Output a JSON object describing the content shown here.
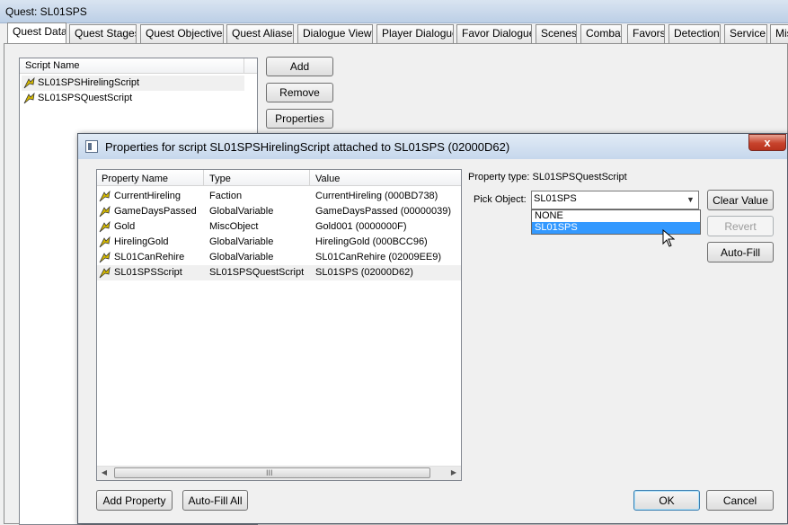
{
  "window": {
    "title": "Quest: SL01SPS"
  },
  "tabs": [
    {
      "label": "Quest Data"
    },
    {
      "label": "Quest Stages"
    },
    {
      "label": "Quest Objectives"
    },
    {
      "label": "Quest Aliases"
    },
    {
      "label": "Dialogue Views"
    },
    {
      "label": "Player Dialogue"
    },
    {
      "label": "Favor Dialogue"
    },
    {
      "label": "Scenes"
    },
    {
      "label": "Combat"
    },
    {
      "label": "Favors"
    },
    {
      "label": "Detection"
    },
    {
      "label": "Service"
    },
    {
      "label": "Mis"
    }
  ],
  "scripts": {
    "header": "Script Name",
    "items": [
      {
        "name": "SL01SPSHirelingScript"
      },
      {
        "name": "SL01SPSQuestScript"
      }
    ],
    "buttons": {
      "add": "Add",
      "remove": "Remove",
      "properties": "Properties"
    }
  },
  "dialog": {
    "title": "Properties for script SL01SPSHirelingScript attached to SL01SPS (02000D62)",
    "close": "x",
    "table": {
      "headers": [
        "Property Name",
        "Type",
        "Value"
      ],
      "rows": [
        {
          "name": "CurrentHireling",
          "type": "Faction",
          "value": "CurrentHireling (000BD738)"
        },
        {
          "name": "GameDaysPassed",
          "type": "GlobalVariable",
          "value": "GameDaysPassed (00000039)"
        },
        {
          "name": "Gold",
          "type": "MiscObject",
          "value": "Gold001 (0000000F)"
        },
        {
          "name": "HirelingGold",
          "type": "GlobalVariable",
          "value": "HirelingGold (000BCC96)"
        },
        {
          "name": "SL01CanRehire",
          "type": "GlobalVariable",
          "value": "SL01CanRehire (02009EE9)"
        },
        {
          "name": "SL01SPSScript",
          "type": "SL01SPSQuestScript",
          "value": "SL01SPS (02000D62)"
        }
      ],
      "scroll_grip": "III"
    },
    "property_type_label": "Property type: SL01SPSQuestScript",
    "pick_object_label": "Pick Object:",
    "pick_object_value": "SL01SPS",
    "dropdown_options": [
      "NONE",
      "SL01SPS"
    ],
    "buttons": {
      "clear_value": "Clear Value",
      "revert": "Revert",
      "auto_fill": "Auto-Fill",
      "add_property": "Add Property",
      "auto_fill_all": "Auto-Fill All",
      "ok": "OK",
      "cancel": "Cancel"
    }
  },
  "colors": {
    "selection": "#3399ff",
    "close_red": "#c7432c"
  }
}
